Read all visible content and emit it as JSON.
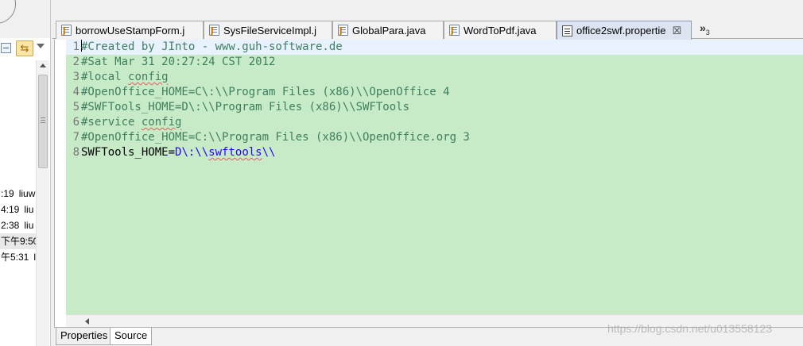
{
  "left_panel": {
    "rows": [
      {
        "time": ":19",
        "user": "liuw"
      },
      {
        "time": "4:19",
        "user": "liu"
      },
      {
        "time": "2:38",
        "user": "liu"
      },
      {
        "time": "下午9:50",
        "user": ""
      },
      {
        "time": "午5:31",
        "user": "l"
      }
    ]
  },
  "tabs": [
    {
      "label": "borrowUseStampForm.j",
      "icon": "java-file-icon"
    },
    {
      "label": "SysFileServiceImpl.j",
      "icon": "java-file-icon"
    },
    {
      "label": "GlobalPara.java",
      "icon": "java-file-icon"
    },
    {
      "label": "WordToPdf.java",
      "icon": "java-file-icon"
    },
    {
      "label": "office2swf.propertie",
      "icon": "properties-file-icon",
      "close": "☒"
    }
  ],
  "tab_overflow": {
    "glyph": "»",
    "count": "3"
  },
  "code": {
    "lines": [
      {
        "no": "1",
        "text": "#Created by JInto - www.guh-software.de"
      },
      {
        "no": "2",
        "text": "#Sat Mar 31 20:27:24 CST 2012"
      },
      {
        "no": "3",
        "pre": "#local ",
        "spell": "config"
      },
      {
        "no": "4",
        "text": "#OpenOffice_HOME=C\\:\\\\Program Files (x86)\\\\OpenOffice 4"
      },
      {
        "no": "5",
        "text": "#SWFTools_HOME=D\\:\\\\Program Files (x86)\\\\SWFTools"
      },
      {
        "no": "6",
        "pre": "#service ",
        "spell": "config"
      },
      {
        "no": "7",
        "text": "#OpenOffice_HOME=C:\\\\Program Files (x86)\\\\OpenOffice.org 3"
      },
      {
        "no": "8",
        "key": "SWFTools_HOME",
        "eq": "=",
        "val_pre": "D\\:\\\\",
        "val_spell": "swftools",
        "val_post": "\\\\"
      }
    ]
  },
  "bottom_tabs": [
    {
      "label": "Properties"
    },
    {
      "label": "Source"
    }
  ],
  "watermark": "https://blog.csdn.net/u013558123",
  "colors": {
    "editor_bg": "#c7eac7",
    "comment": "#3f7f5f",
    "value": "#2a00ff",
    "current_line": "#e8f2fe"
  }
}
